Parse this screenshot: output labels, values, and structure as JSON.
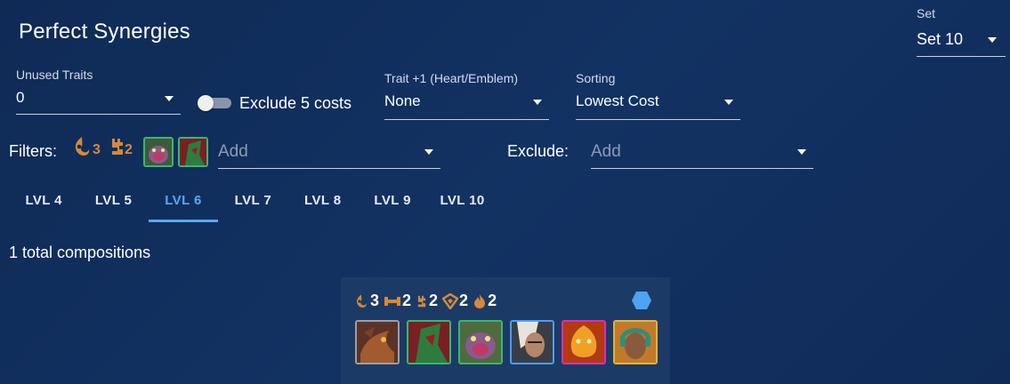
{
  "header": {
    "title": "Perfect Synergies"
  },
  "set": {
    "label": "Set",
    "value": "Set 10"
  },
  "unused_traits": {
    "label": "Unused Traits",
    "value": "0"
  },
  "exclude_five": {
    "label": "Exclude 5 costs",
    "checked": false
  },
  "trait_plus": {
    "label": "Trait +1 (Heart/Emblem)",
    "value": "None"
  },
  "sorting": {
    "label": "Sorting",
    "value": "Lowest Cost"
  },
  "filters": {
    "label": "Filters:",
    "traits": [
      {
        "icon": "crowd-diver-trait-icon",
        "count": "3",
        "color": "#d5893a"
      },
      {
        "icon": "bruiser-trait-icon",
        "count": "2",
        "color": "#d5893a"
      }
    ],
    "champions": [
      {
        "icon": "champion-portrait-green-beast"
      },
      {
        "icon": "champion-portrait-green-hooded"
      }
    ],
    "placeholder": "Add"
  },
  "exclude": {
    "label": "Exclude:",
    "placeholder": "Add"
  },
  "tabs": [
    {
      "label": "LVL 4"
    },
    {
      "label": "LVL 5"
    },
    {
      "label": "LVL 6",
      "active": true
    },
    {
      "label": "LVL 7"
    },
    {
      "label": "LVL 8"
    },
    {
      "label": "LVL 9"
    },
    {
      "label": "LVL 10"
    }
  ],
  "results": {
    "total_text": "1 total compositions"
  },
  "composition": {
    "traits": [
      {
        "icon": "crowd-diver-trait-icon",
        "count": "3"
      },
      {
        "icon": "dumbbell-trait-icon",
        "count": "2"
      },
      {
        "icon": "bruiser-trait-icon",
        "count": "2"
      },
      {
        "icon": "shield-trait-icon",
        "count": "2"
      },
      {
        "icon": "flame-trait-icon",
        "count": "2"
      }
    ],
    "hex_color": "#4ea3f3",
    "champions": [
      {
        "icon": "champion-portrait-brown-dragon",
        "border": "#9aa0a6"
      },
      {
        "icon": "champion-portrait-green-hooded",
        "border": "#39b86a"
      },
      {
        "icon": "champion-portrait-green-beast",
        "border": "#39b86a"
      },
      {
        "icon": "champion-portrait-blue-fighter",
        "border": "#4a9ff5"
      },
      {
        "icon": "champion-portrait-fire-beast",
        "border": "#d62fb8"
      },
      {
        "icon": "champion-portrait-gold-dj",
        "border": "#e2b43a"
      }
    ]
  }
}
